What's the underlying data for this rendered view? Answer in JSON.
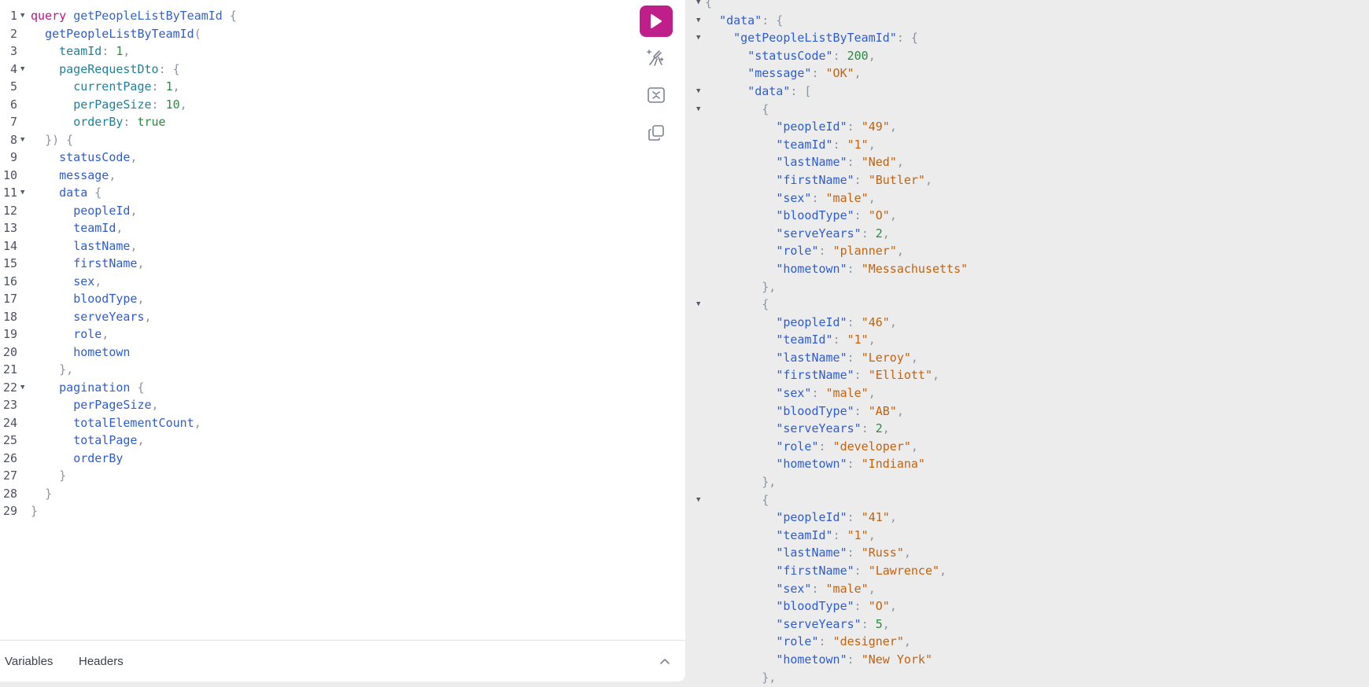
{
  "toolbar": {
    "run_icon": "play-icon",
    "prettify_icon": "magic-wand-icon",
    "merge_icon": "merge-fragments-icon",
    "copy_icon": "copy-icon"
  },
  "bottom_tabs": {
    "variables": "Variables",
    "headers": "Headers"
  },
  "colors": {
    "accent": "#c01f8b",
    "keyword": "#b0178a",
    "field": "#2d5cd2",
    "string": "#c2620e",
    "number": "#2b8a3e"
  },
  "query_lines": [
    {
      "n": "1",
      "fold": true,
      "tokens": [
        [
          "kw",
          "query"
        ],
        [
          "t",
          " "
        ],
        [
          "fn",
          "getPeopleListByTeamId"
        ],
        [
          "t",
          " "
        ],
        [
          "punc",
          "{"
        ]
      ]
    },
    {
      "n": "2",
      "fold": false,
      "tokens": [
        [
          "t",
          "  "
        ],
        [
          "fld",
          "getPeopleListByTeamId"
        ],
        [
          "punc",
          "("
        ]
      ]
    },
    {
      "n": "3",
      "fold": false,
      "tokens": [
        [
          "t",
          "    "
        ],
        [
          "arg",
          "teamId"
        ],
        [
          "punc",
          ":"
        ],
        [
          "t",
          " "
        ],
        [
          "num",
          "1"
        ],
        [
          "punc",
          ","
        ]
      ]
    },
    {
      "n": "4",
      "fold": true,
      "tokens": [
        [
          "t",
          "    "
        ],
        [
          "arg",
          "pageRequestDto"
        ],
        [
          "punc",
          ":"
        ],
        [
          "t",
          " "
        ],
        [
          "punc",
          "{"
        ]
      ]
    },
    {
      "n": "5",
      "fold": false,
      "tokens": [
        [
          "t",
          "      "
        ],
        [
          "arg",
          "currentPage"
        ],
        [
          "punc",
          ":"
        ],
        [
          "t",
          " "
        ],
        [
          "num",
          "1"
        ],
        [
          "punc",
          ","
        ]
      ]
    },
    {
      "n": "6",
      "fold": false,
      "tokens": [
        [
          "t",
          "      "
        ],
        [
          "arg",
          "perPageSize"
        ],
        [
          "punc",
          ":"
        ],
        [
          "t",
          " "
        ],
        [
          "num",
          "10"
        ],
        [
          "punc",
          ","
        ]
      ]
    },
    {
      "n": "7",
      "fold": false,
      "tokens": [
        [
          "t",
          "      "
        ],
        [
          "arg",
          "orderBy"
        ],
        [
          "punc",
          ":"
        ],
        [
          "t",
          " "
        ],
        [
          "bool",
          "true"
        ]
      ]
    },
    {
      "n": "8",
      "fold": true,
      "tokens": [
        [
          "t",
          "  "
        ],
        [
          "punc",
          "})"
        ],
        [
          "t",
          " "
        ],
        [
          "punc",
          "{"
        ]
      ]
    },
    {
      "n": "9",
      "fold": false,
      "tokens": [
        [
          "t",
          "    "
        ],
        [
          "fld",
          "statusCode"
        ],
        [
          "punc",
          ","
        ]
      ]
    },
    {
      "n": "10",
      "fold": false,
      "tokens": [
        [
          "t",
          "    "
        ],
        [
          "fld",
          "message"
        ],
        [
          "punc",
          ","
        ]
      ]
    },
    {
      "n": "11",
      "fold": true,
      "tokens": [
        [
          "t",
          "    "
        ],
        [
          "fld",
          "data"
        ],
        [
          "t",
          " "
        ],
        [
          "punc",
          "{"
        ]
      ]
    },
    {
      "n": "12",
      "fold": false,
      "tokens": [
        [
          "t",
          "      "
        ],
        [
          "fld",
          "peopleId"
        ],
        [
          "punc",
          ","
        ]
      ]
    },
    {
      "n": "13",
      "fold": false,
      "tokens": [
        [
          "t",
          "      "
        ],
        [
          "fld",
          "teamId"
        ],
        [
          "punc",
          ","
        ]
      ]
    },
    {
      "n": "14",
      "fold": false,
      "tokens": [
        [
          "t",
          "      "
        ],
        [
          "fld",
          "lastName"
        ],
        [
          "punc",
          ","
        ]
      ]
    },
    {
      "n": "15",
      "fold": false,
      "tokens": [
        [
          "t",
          "      "
        ],
        [
          "fld",
          "firstName"
        ],
        [
          "punc",
          ","
        ]
      ]
    },
    {
      "n": "16",
      "fold": false,
      "tokens": [
        [
          "t",
          "      "
        ],
        [
          "fld",
          "sex"
        ],
        [
          "punc",
          ","
        ]
      ]
    },
    {
      "n": "17",
      "fold": false,
      "tokens": [
        [
          "t",
          "      "
        ],
        [
          "fld",
          "bloodType"
        ],
        [
          "punc",
          ","
        ]
      ]
    },
    {
      "n": "18",
      "fold": false,
      "tokens": [
        [
          "t",
          "      "
        ],
        [
          "fld",
          "serveYears"
        ],
        [
          "punc",
          ","
        ]
      ]
    },
    {
      "n": "19",
      "fold": false,
      "tokens": [
        [
          "t",
          "      "
        ],
        [
          "fld",
          "role"
        ],
        [
          "punc",
          ","
        ]
      ]
    },
    {
      "n": "20",
      "fold": false,
      "tokens": [
        [
          "t",
          "      "
        ],
        [
          "fld",
          "hometown"
        ]
      ]
    },
    {
      "n": "21",
      "fold": false,
      "tokens": [
        [
          "t",
          "    "
        ],
        [
          "punc",
          "},"
        ]
      ]
    },
    {
      "n": "22",
      "fold": true,
      "tokens": [
        [
          "t",
          "    "
        ],
        [
          "fld",
          "pagination"
        ],
        [
          "t",
          " "
        ],
        [
          "punc",
          "{"
        ]
      ]
    },
    {
      "n": "23",
      "fold": false,
      "tokens": [
        [
          "t",
          "      "
        ],
        [
          "fld",
          "perPageSize"
        ],
        [
          "punc",
          ","
        ]
      ]
    },
    {
      "n": "24",
      "fold": false,
      "tokens": [
        [
          "t",
          "      "
        ],
        [
          "fld",
          "totalElementCount"
        ],
        [
          "punc",
          ","
        ]
      ]
    },
    {
      "n": "25",
      "fold": false,
      "tokens": [
        [
          "t",
          "      "
        ],
        [
          "fld",
          "totalPage"
        ],
        [
          "punc",
          ","
        ]
      ]
    },
    {
      "n": "26",
      "fold": false,
      "tokens": [
        [
          "t",
          "      "
        ],
        [
          "fld",
          "orderBy"
        ]
      ]
    },
    {
      "n": "27",
      "fold": false,
      "tokens": [
        [
          "t",
          "    "
        ],
        [
          "punc",
          "}"
        ]
      ]
    },
    {
      "n": "28",
      "fold": false,
      "tokens": [
        [
          "t",
          "  "
        ],
        [
          "punc",
          "}"
        ]
      ]
    },
    {
      "n": "29",
      "fold": false,
      "tokens": [
        [
          "punc",
          "}"
        ]
      ]
    }
  ],
  "result_lines": [
    {
      "fold": true,
      "tokens": [
        [
          "rpunc",
          "{"
        ]
      ]
    },
    {
      "fold": true,
      "tokens": [
        [
          "t",
          "  "
        ],
        [
          "key",
          "\"data\""
        ],
        [
          "rpunc",
          ": {"
        ]
      ]
    },
    {
      "fold": true,
      "tokens": [
        [
          "t",
          "    "
        ],
        [
          "key",
          "\"getPeopleListByTeamId\""
        ],
        [
          "rpunc",
          ": {"
        ]
      ]
    },
    {
      "fold": false,
      "tokens": [
        [
          "t",
          "      "
        ],
        [
          "key",
          "\"statusCode\""
        ],
        [
          "rpunc",
          ": "
        ],
        [
          "rnum",
          "200"
        ],
        [
          "rpunc",
          ","
        ]
      ]
    },
    {
      "fold": false,
      "tokens": [
        [
          "t",
          "      "
        ],
        [
          "key",
          "\"message\""
        ],
        [
          "rpunc",
          ": "
        ],
        [
          "str",
          "\"OK\""
        ],
        [
          "rpunc",
          ","
        ]
      ]
    },
    {
      "fold": true,
      "tokens": [
        [
          "t",
          "      "
        ],
        [
          "key",
          "\"data\""
        ],
        [
          "rpunc",
          ": ["
        ]
      ]
    },
    {
      "fold": true,
      "tokens": [
        [
          "t",
          "        "
        ],
        [
          "rpunc",
          "{"
        ]
      ]
    },
    {
      "fold": false,
      "tokens": [
        [
          "t",
          "          "
        ],
        [
          "key",
          "\"peopleId\""
        ],
        [
          "rpunc",
          ": "
        ],
        [
          "str",
          "\"49\""
        ],
        [
          "rpunc",
          ","
        ]
      ]
    },
    {
      "fold": false,
      "tokens": [
        [
          "t",
          "          "
        ],
        [
          "key",
          "\"teamId\""
        ],
        [
          "rpunc",
          ": "
        ],
        [
          "str",
          "\"1\""
        ],
        [
          "rpunc",
          ","
        ]
      ]
    },
    {
      "fold": false,
      "tokens": [
        [
          "t",
          "          "
        ],
        [
          "key",
          "\"lastName\""
        ],
        [
          "rpunc",
          ": "
        ],
        [
          "str",
          "\"Ned\""
        ],
        [
          "rpunc",
          ","
        ]
      ]
    },
    {
      "fold": false,
      "tokens": [
        [
          "t",
          "          "
        ],
        [
          "key",
          "\"firstName\""
        ],
        [
          "rpunc",
          ": "
        ],
        [
          "str",
          "\"Butler\""
        ],
        [
          "rpunc",
          ","
        ]
      ]
    },
    {
      "fold": false,
      "tokens": [
        [
          "t",
          "          "
        ],
        [
          "key",
          "\"sex\""
        ],
        [
          "rpunc",
          ": "
        ],
        [
          "str",
          "\"male\""
        ],
        [
          "rpunc",
          ","
        ]
      ]
    },
    {
      "fold": false,
      "tokens": [
        [
          "t",
          "          "
        ],
        [
          "key",
          "\"bloodType\""
        ],
        [
          "rpunc",
          ": "
        ],
        [
          "str",
          "\"O\""
        ],
        [
          "rpunc",
          ","
        ]
      ]
    },
    {
      "fold": false,
      "tokens": [
        [
          "t",
          "          "
        ],
        [
          "key",
          "\"serveYears\""
        ],
        [
          "rpunc",
          ": "
        ],
        [
          "rnum",
          "2"
        ],
        [
          "rpunc",
          ","
        ]
      ]
    },
    {
      "fold": false,
      "tokens": [
        [
          "t",
          "          "
        ],
        [
          "key",
          "\"role\""
        ],
        [
          "rpunc",
          ": "
        ],
        [
          "str",
          "\"planner\""
        ],
        [
          "rpunc",
          ","
        ]
      ]
    },
    {
      "fold": false,
      "tokens": [
        [
          "t",
          "          "
        ],
        [
          "key",
          "\"hometown\""
        ],
        [
          "rpunc",
          ": "
        ],
        [
          "str",
          "\"Messachusetts\""
        ]
      ]
    },
    {
      "fold": false,
      "tokens": [
        [
          "t",
          "        "
        ],
        [
          "rpunc",
          "},"
        ]
      ]
    },
    {
      "fold": true,
      "tokens": [
        [
          "t",
          "        "
        ],
        [
          "rpunc",
          "{"
        ]
      ]
    },
    {
      "fold": false,
      "tokens": [
        [
          "t",
          "          "
        ],
        [
          "key",
          "\"peopleId\""
        ],
        [
          "rpunc",
          ": "
        ],
        [
          "str",
          "\"46\""
        ],
        [
          "rpunc",
          ","
        ]
      ]
    },
    {
      "fold": false,
      "tokens": [
        [
          "t",
          "          "
        ],
        [
          "key",
          "\"teamId\""
        ],
        [
          "rpunc",
          ": "
        ],
        [
          "str",
          "\"1\""
        ],
        [
          "rpunc",
          ","
        ]
      ]
    },
    {
      "fold": false,
      "tokens": [
        [
          "t",
          "          "
        ],
        [
          "key",
          "\"lastName\""
        ],
        [
          "rpunc",
          ": "
        ],
        [
          "str",
          "\"Leroy\""
        ],
        [
          "rpunc",
          ","
        ]
      ]
    },
    {
      "fold": false,
      "tokens": [
        [
          "t",
          "          "
        ],
        [
          "key",
          "\"firstName\""
        ],
        [
          "rpunc",
          ": "
        ],
        [
          "str",
          "\"Elliott\""
        ],
        [
          "rpunc",
          ","
        ]
      ]
    },
    {
      "fold": false,
      "tokens": [
        [
          "t",
          "          "
        ],
        [
          "key",
          "\"sex\""
        ],
        [
          "rpunc",
          ": "
        ],
        [
          "str",
          "\"male\""
        ],
        [
          "rpunc",
          ","
        ]
      ]
    },
    {
      "fold": false,
      "tokens": [
        [
          "t",
          "          "
        ],
        [
          "key",
          "\"bloodType\""
        ],
        [
          "rpunc",
          ": "
        ],
        [
          "str",
          "\"AB\""
        ],
        [
          "rpunc",
          ","
        ]
      ]
    },
    {
      "fold": false,
      "tokens": [
        [
          "t",
          "          "
        ],
        [
          "key",
          "\"serveYears\""
        ],
        [
          "rpunc",
          ": "
        ],
        [
          "rnum",
          "2"
        ],
        [
          "rpunc",
          ","
        ]
      ]
    },
    {
      "fold": false,
      "tokens": [
        [
          "t",
          "          "
        ],
        [
          "key",
          "\"role\""
        ],
        [
          "rpunc",
          ": "
        ],
        [
          "str",
          "\"developer\""
        ],
        [
          "rpunc",
          ","
        ]
      ]
    },
    {
      "fold": false,
      "tokens": [
        [
          "t",
          "          "
        ],
        [
          "key",
          "\"hometown\""
        ],
        [
          "rpunc",
          ": "
        ],
        [
          "str",
          "\"Indiana\""
        ]
      ]
    },
    {
      "fold": false,
      "tokens": [
        [
          "t",
          "        "
        ],
        [
          "rpunc",
          "},"
        ]
      ]
    },
    {
      "fold": true,
      "tokens": [
        [
          "t",
          "        "
        ],
        [
          "rpunc",
          "{"
        ]
      ]
    },
    {
      "fold": false,
      "tokens": [
        [
          "t",
          "          "
        ],
        [
          "key",
          "\"peopleId\""
        ],
        [
          "rpunc",
          ": "
        ],
        [
          "str",
          "\"41\""
        ],
        [
          "rpunc",
          ","
        ]
      ]
    },
    {
      "fold": false,
      "tokens": [
        [
          "t",
          "          "
        ],
        [
          "key",
          "\"teamId\""
        ],
        [
          "rpunc",
          ": "
        ],
        [
          "str",
          "\"1\""
        ],
        [
          "rpunc",
          ","
        ]
      ]
    },
    {
      "fold": false,
      "tokens": [
        [
          "t",
          "          "
        ],
        [
          "key",
          "\"lastName\""
        ],
        [
          "rpunc",
          ": "
        ],
        [
          "str",
          "\"Russ\""
        ],
        [
          "rpunc",
          ","
        ]
      ]
    },
    {
      "fold": false,
      "tokens": [
        [
          "t",
          "          "
        ],
        [
          "key",
          "\"firstName\""
        ],
        [
          "rpunc",
          ": "
        ],
        [
          "str",
          "\"Lawrence\""
        ],
        [
          "rpunc",
          ","
        ]
      ]
    },
    {
      "fold": false,
      "tokens": [
        [
          "t",
          "          "
        ],
        [
          "key",
          "\"sex\""
        ],
        [
          "rpunc",
          ": "
        ],
        [
          "str",
          "\"male\""
        ],
        [
          "rpunc",
          ","
        ]
      ]
    },
    {
      "fold": false,
      "tokens": [
        [
          "t",
          "          "
        ],
        [
          "key",
          "\"bloodType\""
        ],
        [
          "rpunc",
          ": "
        ],
        [
          "str",
          "\"O\""
        ],
        [
          "rpunc",
          ","
        ]
      ]
    },
    {
      "fold": false,
      "tokens": [
        [
          "t",
          "          "
        ],
        [
          "key",
          "\"serveYears\""
        ],
        [
          "rpunc",
          ": "
        ],
        [
          "rnum",
          "5"
        ],
        [
          "rpunc",
          ","
        ]
      ]
    },
    {
      "fold": false,
      "tokens": [
        [
          "t",
          "          "
        ],
        [
          "key",
          "\"role\""
        ],
        [
          "rpunc",
          ": "
        ],
        [
          "str",
          "\"designer\""
        ],
        [
          "rpunc",
          ","
        ]
      ]
    },
    {
      "fold": false,
      "tokens": [
        [
          "t",
          "          "
        ],
        [
          "key",
          "\"hometown\""
        ],
        [
          "rpunc",
          ": "
        ],
        [
          "str",
          "\"New York\""
        ]
      ]
    },
    {
      "fold": false,
      "tokens": [
        [
          "t",
          "        "
        ],
        [
          "rpunc",
          "},"
        ]
      ]
    }
  ]
}
